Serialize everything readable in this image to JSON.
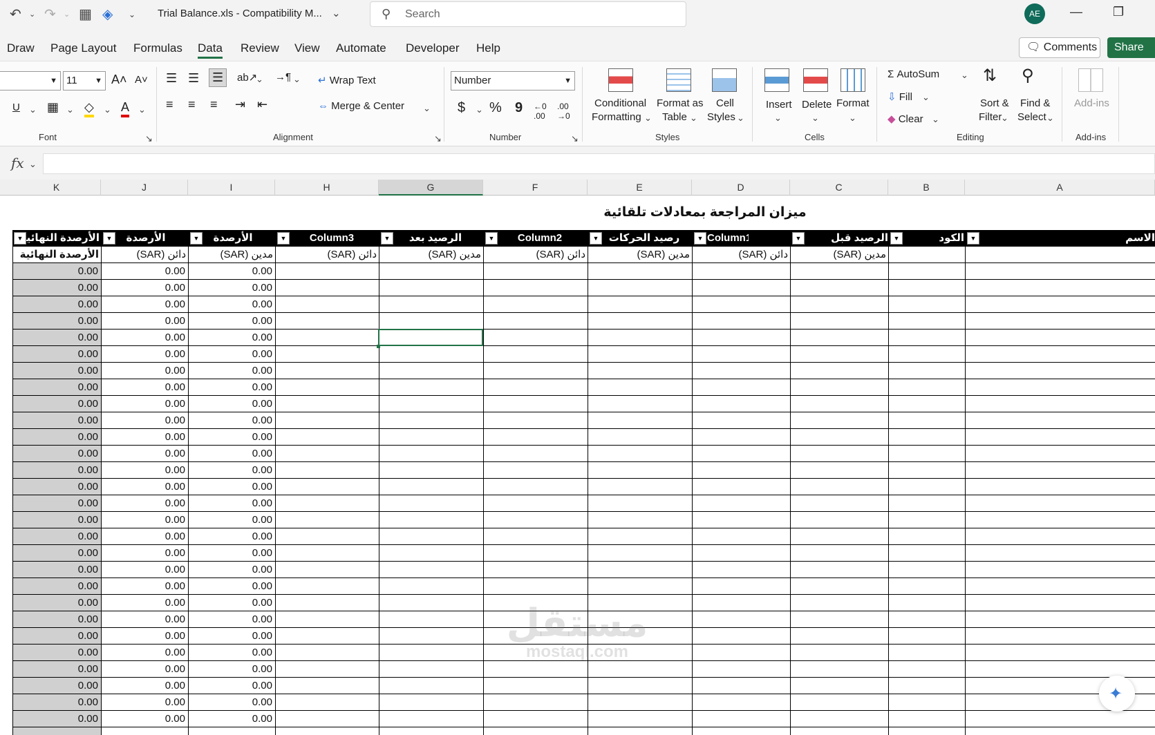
{
  "titlebar": {
    "filename": "Trial Balance.xls  -  Compatibility M...",
    "search_placeholder": "Search",
    "avatar_initials": "AE"
  },
  "tabs": [
    "Draw",
    "Page Layout",
    "Formulas",
    "Data",
    "Review",
    "View",
    "Automate",
    "Developer",
    "Help"
  ],
  "active_tab": "Data",
  "actions": {
    "comments": "Comments",
    "share": "Share"
  },
  "ribbon": {
    "font": {
      "size": "11",
      "group": "Font"
    },
    "alignment": {
      "wrap_text": "Wrap Text",
      "merge_center": "Merge & Center",
      "group": "Alignment"
    },
    "number": {
      "format": "Number",
      "group": "Number",
      "currency": "$",
      "percent": "%",
      "comma": "9"
    },
    "styles": {
      "conditional": [
        "Conditional",
        "Formatting"
      ],
      "format_table": [
        "Format as",
        "Table"
      ],
      "cell_styles": [
        "Cell",
        "Styles"
      ],
      "group": "Styles"
    },
    "cells": {
      "insert": "Insert",
      "delete": "Delete",
      "format": "Format",
      "group": "Cells"
    },
    "editing": {
      "autosum": "AutoSum",
      "fill": "Fill",
      "clear": "Clear",
      "sort": [
        "Sort &",
        "Filter"
      ],
      "find": [
        "Find &",
        "Select"
      ],
      "group": "Editing"
    },
    "addins": {
      "label": "Add-ins",
      "group": "Add-ins"
    }
  },
  "formula_bar": {
    "fx": "fx",
    "value": ""
  },
  "column_letters": [
    "K",
    "J",
    "I",
    "H",
    "G",
    "F",
    "E",
    "D",
    "C",
    "B",
    "A"
  ],
  "selected_column": "G",
  "sheet": {
    "title": "ميزان المراجعة بمعادلات تلقائية",
    "headers": {
      "K": "الأرصدة النهائية",
      "J": "الأرصدة",
      "I": "الأرصدة",
      "H": "Column3",
      "G": "الرصيد بعد",
      "F": "Column2",
      "E": "رصيد الحركات",
      "D": "Column1",
      "C": "الرصيد قبل",
      "B": "الكود",
      "A": "الاسم"
    },
    "subheaders": {
      "K": "الأرصدة النهائية",
      "J": "دائن (SAR)",
      "I": "مدين (SAR)",
      "H": "دائن (SAR)",
      "G": "مدين (SAR)",
      "F": "دائن (SAR)",
      "E": "مدين (SAR)",
      "D": "دائن (SAR)",
      "C": "مدين (SAR)"
    },
    "zero_value": "0.00",
    "data_rows": 28
  },
  "watermark": {
    "arabic": "مستقل",
    "latin": "mostaql.com"
  }
}
